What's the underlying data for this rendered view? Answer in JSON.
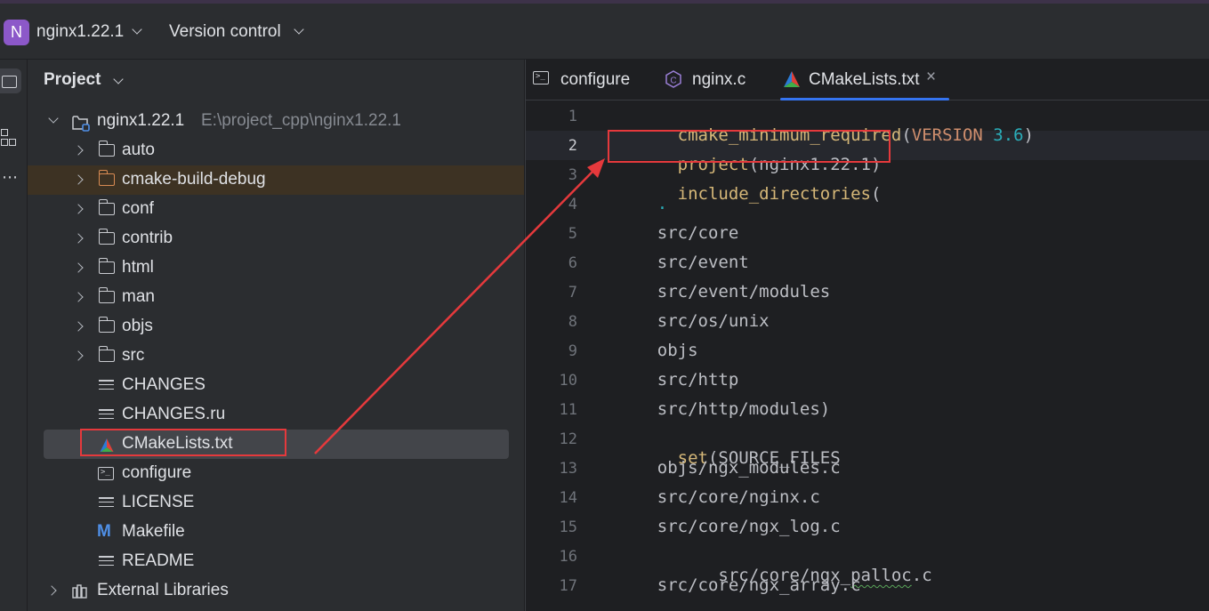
{
  "titlebar": {
    "project_badge": "N",
    "project_name": "nginx1.22.1",
    "vcs_label": "Version control"
  },
  "panel": {
    "title": "Project",
    "root": {
      "label": "nginx1.22.1",
      "path": "E:\\project_cpp\\nginx1.22.1"
    },
    "items": [
      {
        "label": "auto",
        "type": "folder"
      },
      {
        "label": "cmake-build-debug",
        "type": "folder-excluded"
      },
      {
        "label": "conf",
        "type": "folder"
      },
      {
        "label": "contrib",
        "type": "folder"
      },
      {
        "label": "html",
        "type": "folder"
      },
      {
        "label": "man",
        "type": "folder"
      },
      {
        "label": "objs",
        "type": "folder"
      },
      {
        "label": "src",
        "type": "folder"
      },
      {
        "label": "CHANGES",
        "type": "text-file"
      },
      {
        "label": "CHANGES.ru",
        "type": "text-file"
      },
      {
        "label": "CMakeLists.txt",
        "type": "cmake-file"
      },
      {
        "label": "configure",
        "type": "shell-file"
      },
      {
        "label": "LICENSE",
        "type": "text-file"
      },
      {
        "label": "Makefile",
        "type": "makefile"
      },
      {
        "label": "README",
        "type": "text-file"
      }
    ],
    "external": "External Libraries"
  },
  "tabs": [
    {
      "label": "configure",
      "icon": "terminal-icon"
    },
    {
      "label": "nginx.c",
      "icon": "c-file-icon"
    },
    {
      "label": "CMakeLists.txt",
      "icon": "cmake-icon",
      "active": true
    }
  ],
  "editor": {
    "line_numbers": [
      "1",
      "2",
      "3",
      "4",
      "5",
      "6",
      "7",
      "8",
      "9",
      "10",
      "11",
      "12",
      "13",
      "14",
      "15",
      "16",
      "17"
    ],
    "current_line": 2,
    "lines": {
      "l1_func": "cmake_minimum_required",
      "l1_open": "(",
      "l1_kw": "VERSION",
      "l1_num": " 3.6",
      "l1_close": ")",
      "l2_func": "project",
      "l2_open": "(",
      "l2_arg": "nginx1.22.1",
      "l2_close": ")",
      "l3_func": "include_directories",
      "l3_open": "(",
      "l4": "    .",
      "l5": "    src/core",
      "l6": "    src/event",
      "l7": "    src/event/modules",
      "l8": "    src/os/unix",
      "l9": "    objs",
      "l10": "    src/http",
      "l11": "    src/http/modules)",
      "l12_func": "set",
      "l12_rest": "(SOURCE_FILES",
      "l13": "    objs/ngx_modules.c",
      "l14": "    src/core/nginx.c",
      "l15": "    src/core/ngx_log.c",
      "l16_a": "    src/core/ngx_",
      "l16_b": "palloc",
      "l16_c": ".c",
      "l17": "    src/core/ngx_array.c"
    }
  },
  "colors": {
    "accent": "#3574f0",
    "annotation_red": "#e5393c",
    "project_badge": "#8c58c9",
    "keyword_yellow": "#d5b778",
    "number_teal": "#2aacb8"
  }
}
